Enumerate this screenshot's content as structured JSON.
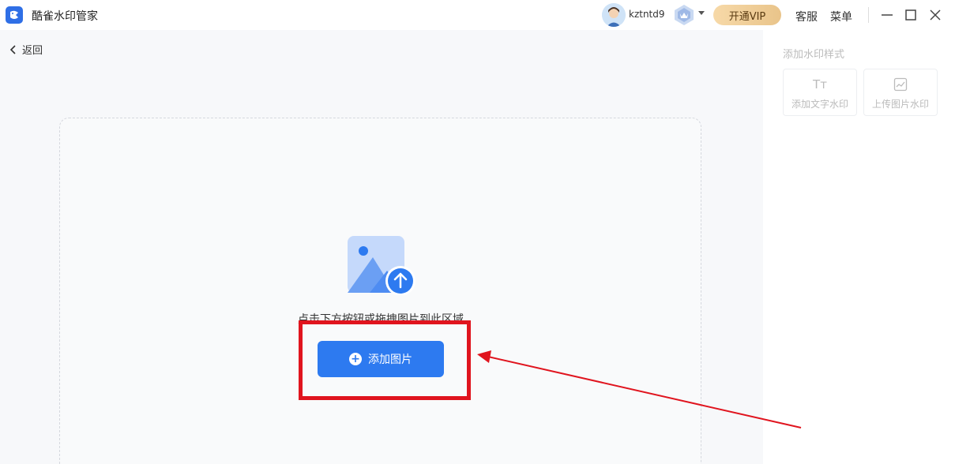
{
  "app": {
    "title": "酷雀水印管家"
  },
  "user": {
    "name": "kztntd9"
  },
  "titlebar": {
    "vip_label": "开通VIP",
    "service_label": "客服",
    "menu_label": "菜单"
  },
  "nav": {
    "back_label": "返回"
  },
  "upload": {
    "hint": "点击下方按钮或拖拽图片到此区域",
    "add_button_label": "添加图片"
  },
  "panel": {
    "title": "添加水印样式",
    "options": [
      {
        "label": "添加文字水印",
        "icon": "text-icon"
      },
      {
        "label": "上传图片水印",
        "icon": "image-icon"
      }
    ]
  },
  "colors": {
    "primary": "#2d7af0",
    "annotation_red": "#e0141e",
    "vip_gold": "#e9c48a"
  }
}
